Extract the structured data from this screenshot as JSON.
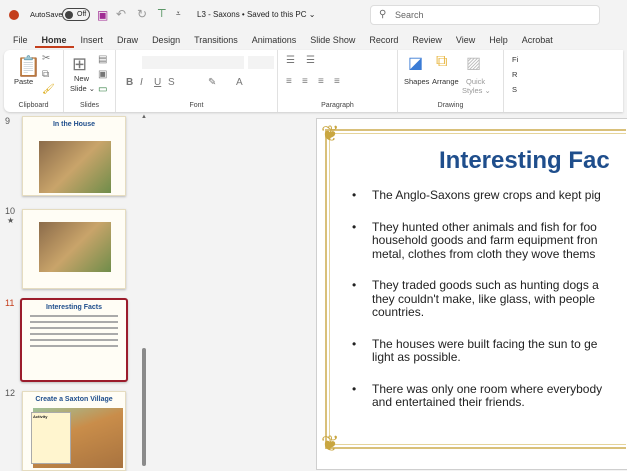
{
  "titlebar": {
    "autosave": "AutoSave",
    "toggle": "Off",
    "doc_title": "L3 - Saxons • Saved to this PC ⌄",
    "search_placeholder": "Search"
  },
  "tabs": [
    "File",
    "Home",
    "Insert",
    "Draw",
    "Design",
    "Transitions",
    "Animations",
    "Slide Show",
    "Record",
    "Review",
    "View",
    "Help",
    "Acrobat"
  ],
  "ribbon": {
    "paste": "Paste",
    "clipboard": "Clipboard",
    "new_slide": "New",
    "new_slide2": "Slide ⌄",
    "slides": "Slides",
    "font": "Font",
    "paragraph": "Paragraph",
    "shapes": "Shapes",
    "arrange": "Arrange",
    "quick": "Quick",
    "quick2": "Styles ⌄",
    "drawing": "Drawing",
    "find": "Fi",
    "replace": "R",
    "select": "S"
  },
  "thumbnails": [
    {
      "number": "9",
      "title": "In the House"
    },
    {
      "number": "10",
      "title": ""
    },
    {
      "number": "11",
      "title": "Interesting Facts"
    },
    {
      "number": "12",
      "title": "Create a Saxton Village",
      "activity": "Activity"
    }
  ],
  "slide": {
    "title": "Interesting Fac",
    "bullets": [
      [
        "The Anglo-Saxons grew crops and kept pig"
      ],
      [
        "They hunted other animals and fish for foo",
        "household goods and farm equipment fron",
        "metal, clothes from cloth they wove thems"
      ],
      [
        "They traded goods such as hunting dogs a",
        "they couldn't make, like glass, with people",
        "countries."
      ],
      [
        "The houses were built facing the sun to ge",
        "light as possible."
      ],
      [
        "There was only one room where everybody",
        "and entertained their friends."
      ]
    ]
  },
  "colors": {
    "accent": "#c43e1c",
    "title_blue": "#1f4e8c",
    "gold": "#d9c07a",
    "selected": "#9b1c2c"
  }
}
